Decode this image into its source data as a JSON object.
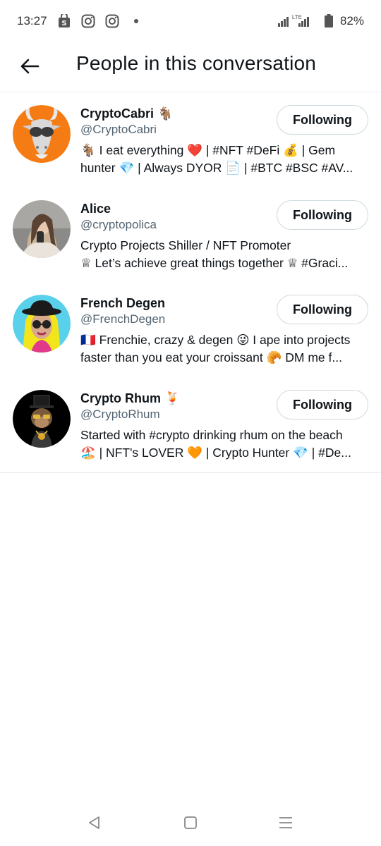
{
  "status_bar": {
    "time": "13:27",
    "network": "LTE",
    "battery": "82%"
  },
  "header": {
    "title": "People in this conversation"
  },
  "users": [
    {
      "name": "CryptoCabri 🐐",
      "handle": "@CryptoCabri",
      "bio_line1": "🐐 I eat everything ❤️ | #NFT #DeFi 💰 | Gem",
      "bio_line2": "hunter 💎 | Always DYOR 📄 | #BTC #BSC #AV...",
      "button": "Following"
    },
    {
      "name": "Alice",
      "handle": "@cryptopolica",
      "bio_line1": "Crypto Projects Shiller / NFT Promoter",
      "bio_line2": "♕ Let’s achieve great things together ♕ #Graci...",
      "button": "Following"
    },
    {
      "name": "French Degen",
      "handle": "@FrenchDegen",
      "bio_line1": "🇫🇷 Frenchie, crazy & degen 😜 I ape into projects",
      "bio_line2": "faster than you eat your croissant 🥐 DM me f...",
      "button": "Following"
    },
    {
      "name": "Crypto Rhum 🍹",
      "handle": "@CryptoRhum",
      "bio_line1": "Started with #crypto drinking rhum on the beach",
      "bio_line2": "🏖️ | NFT's LOVER 🧡 | Crypto Hunter 💎 | #De...",
      "button": "Following"
    }
  ],
  "colors": {
    "text": "#0f1419",
    "secondary": "#536471",
    "border": "#cfd9de",
    "avatar1_bg": "#f57c14",
    "avatar3_bg": "#5ad1ea",
    "avatar4_bg": "#000000"
  }
}
